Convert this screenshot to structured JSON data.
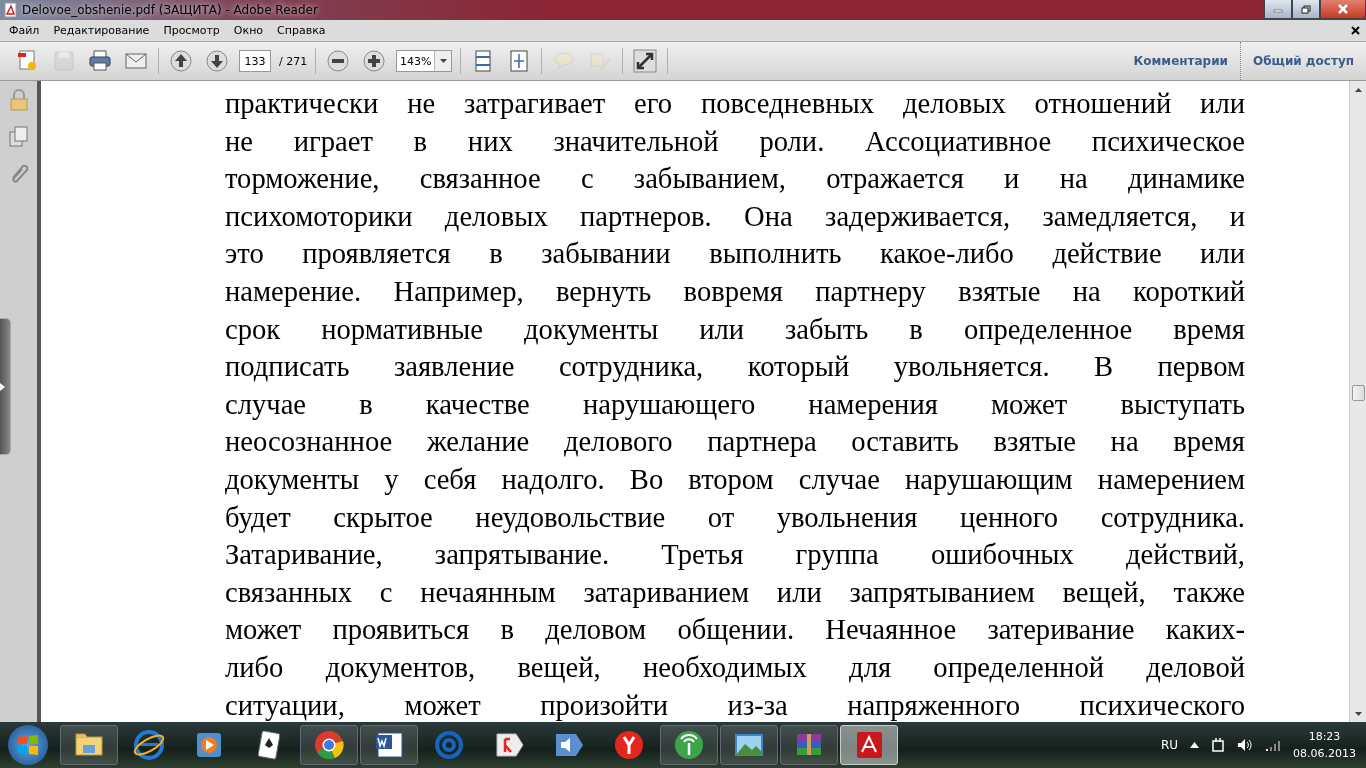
{
  "window": {
    "title": "Delovoe_obshenie.pdf (ЗАЩИТА) - Adobe Reader"
  },
  "menu": {
    "items": [
      "Файл",
      "Редактирование",
      "Просмотр",
      "Окно",
      "Справка"
    ]
  },
  "toolbar": {
    "groups": [
      [
        {
          "kind": "create",
          "disabled": false
        },
        {
          "kind": "save",
          "disabled": true
        },
        {
          "kind": "print",
          "disabled": false
        },
        {
          "kind": "email",
          "disabled": false
        }
      ],
      [
        {
          "kind": "prev",
          "disabled": false
        },
        {
          "kind": "next",
          "disabled": false
        },
        {
          "kind": "page-field",
          "value": "133",
          "total": "/ 271"
        }
      ],
      [
        {
          "kind": "zoom-out",
          "disabled": false
        },
        {
          "kind": "zoom-in",
          "disabled": false
        },
        {
          "kind": "zoom-field",
          "value": "143%"
        }
      ],
      [
        {
          "kind": "fit-height",
          "disabled": false
        },
        {
          "kind": "fit-page",
          "disabled": false
        }
      ],
      [
        {
          "kind": "comment",
          "disabled": true
        },
        {
          "kind": "highlight",
          "disabled": true
        }
      ],
      [
        {
          "kind": "fullscreen",
          "disabled": false
        }
      ]
    ],
    "links": [
      "Комментарии",
      "Общий доступ"
    ]
  },
  "sidebar": {
    "icons": [
      {
        "kind": "lock"
      },
      {
        "kind": "pages"
      },
      {
        "kind": "attachment"
      }
    ]
  },
  "document": {
    "lines": [
      "практически не затрагивает его повседневных деловых отношений или",
      "не играет в них значительной роли. Ассоциативное психическое",
      "торможение, связанное с забыванием, отражается и на динамике",
      "психомоторики деловых партнеров. Она задерживается, замедляется, и",
      "это проявляется в забывании выполнить какое-либо действие или",
      "намерение. Например, вернуть вовремя партнеру взятые на короткий",
      "срок нормативные документы или забыть в определенное время",
      "подписать заявление сотрудника, который увольняется. В первом",
      "случае в качестве нарушающего намерения может выступать",
      "неосознанное желание делового партнера оставить взятые на время",
      "документы у себя надолго. Во втором случае нарушающим намерением",
      "будет скрытое неудовольствие от увольнения ценного сотрудника.",
      "Затаривание, запрятывание. Третья группа ошибочных действий,",
      "связанных с нечаянным затариванием или запрятыванием вещей, также",
      "может проявиться в деловом общении. Нечаянное затеривание каких-",
      "либо документов, вещей, необходимых для определенной деловой",
      "ситуации, может произойти из-за напряженного психического"
    ]
  },
  "taskbar": {
    "apps": [
      {
        "kind": "folder",
        "running": true,
        "selected": false
      },
      {
        "kind": "browser-e",
        "running": false,
        "selected": false
      },
      {
        "kind": "media",
        "running": false,
        "selected": false
      },
      {
        "kind": "cards",
        "running": false,
        "selected": false
      },
      {
        "kind": "chrome",
        "running": true,
        "selected": false
      },
      {
        "kind": "word",
        "running": true,
        "selected": false
      },
      {
        "kind": "at",
        "running": false,
        "selected": false
      },
      {
        "kind": "ya",
        "running": false,
        "selected": false
      },
      {
        "kind": "speaker-app",
        "running": false,
        "selected": false
      },
      {
        "kind": "y-browser",
        "running": false,
        "selected": false
      },
      {
        "kind": "radio",
        "running": true,
        "selected": false
      },
      {
        "kind": "photo",
        "running": true,
        "selected": false
      },
      {
        "kind": "archive",
        "running": true,
        "selected": false
      },
      {
        "kind": "pdf",
        "running": true,
        "selected": true
      }
    ],
    "language": "RU",
    "time": "18:23",
    "date": "08.06.2013"
  }
}
